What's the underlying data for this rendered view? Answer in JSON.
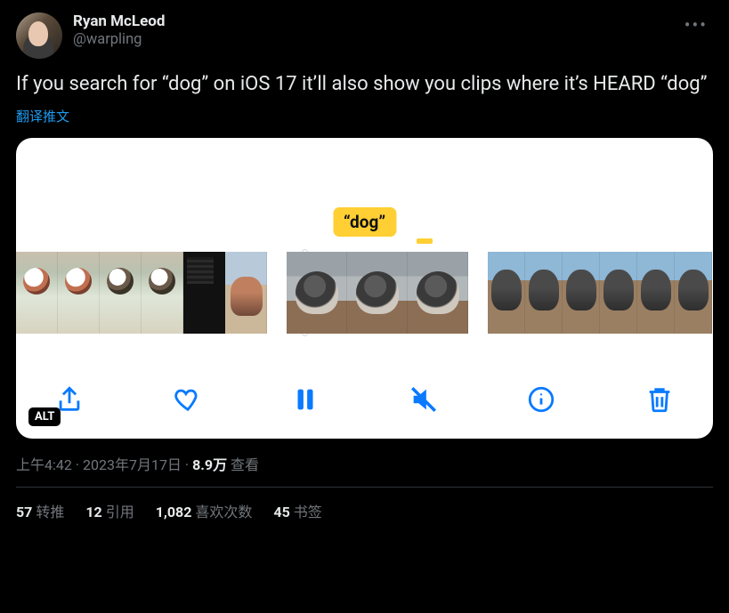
{
  "author": {
    "display_name": "Ryan McLeod",
    "handle": "@warpling"
  },
  "body": "If you search for “dog” on iOS 17 it’ll also show you clips where it’s HEARD “dog”",
  "translate_label": "翻译推文",
  "media": {
    "search_tag": "“dog”",
    "alt_badge": "ALT"
  },
  "meta": {
    "time": "上午4:42",
    "sep1": " · ",
    "date": "2023年7月17日",
    "sep2": " · ",
    "views_count": "8.9万",
    "views_label": " 查看"
  },
  "stats": {
    "retweets_count": "57",
    "retweets_label": "转推",
    "quotes_count": "12",
    "quotes_label": "引用",
    "likes_count": "1,082",
    "likes_label": "喜欢次数",
    "bookmarks_count": "45",
    "bookmarks_label": "书签"
  }
}
